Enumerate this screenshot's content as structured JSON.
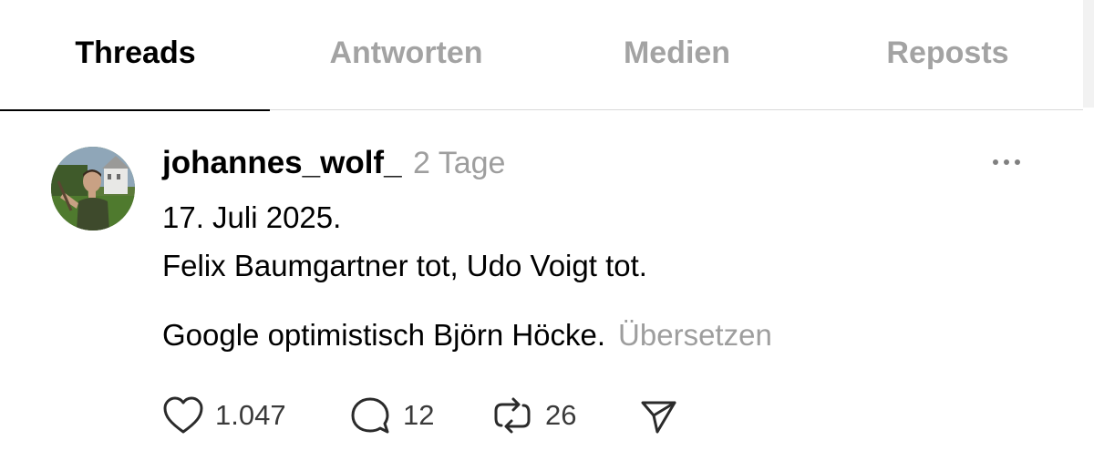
{
  "tabs": {
    "threads": "Threads",
    "replies": "Antworten",
    "media": "Medien",
    "reposts": "Reposts"
  },
  "post": {
    "username": "johannes_wolf_",
    "time": "2 Tage",
    "lines": {
      "date": "17. Juli 2025.",
      "text1": "Felix Baumgartner tot, Udo Voigt tot.",
      "text2": "Google optimistisch Björn Höcke."
    },
    "translate_label": "Übersetzen",
    "actions": {
      "likes": "1.047",
      "comments": "12",
      "reposts": "26"
    },
    "icons": {
      "more": "more-horizontal-icon",
      "like": "heart-icon",
      "comment": "speech-bubble-icon",
      "repost": "repost-arrows-icon",
      "share": "send-icon"
    }
  },
  "colors": {
    "active_tab": "#000000",
    "inactive_tab": "#a3a3a3",
    "muted_text": "#9e9e9e",
    "divider": "#d9d9d9"
  }
}
